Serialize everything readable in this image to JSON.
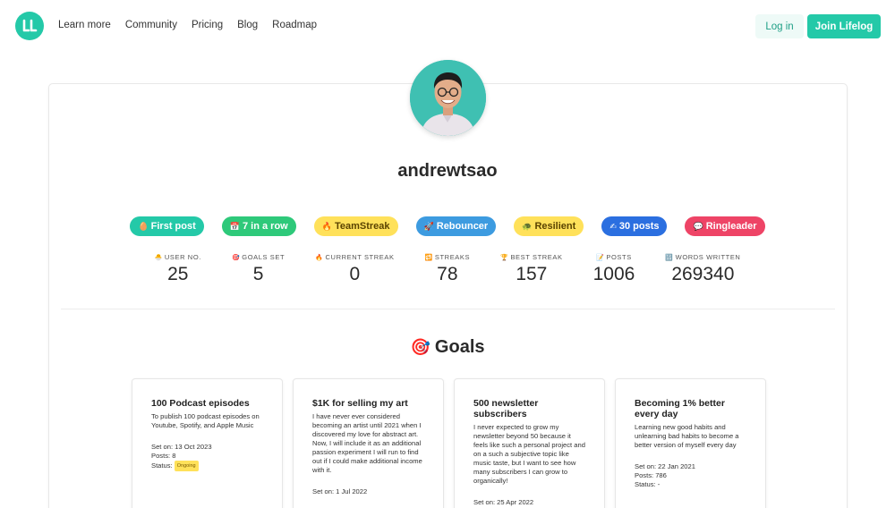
{
  "nav": {
    "links": [
      "Learn more",
      "Community",
      "Pricing",
      "Blog",
      "Roadmap"
    ],
    "login": "Log in",
    "join": "Join Lifelog"
  },
  "profile": {
    "username": "andrewtsao"
  },
  "badges": [
    {
      "label": "First post",
      "icon": "egg-icon",
      "bg": "#24c9a8",
      "fg": "#ffffff"
    },
    {
      "label": "7 in a row",
      "icon": "calendar-icon",
      "bg": "#2ec97a",
      "fg": "#ffffff"
    },
    {
      "label": "TeamStreak",
      "icon": "fire-icon",
      "bg": "#ffe15a",
      "fg": "#5a4300"
    },
    {
      "label": "Rebouncer",
      "icon": "rocket-icon",
      "bg": "#3d9be0",
      "fg": "#ffffff"
    },
    {
      "label": "Resilient",
      "icon": "turtle-icon",
      "bg": "#ffe15a",
      "fg": "#5a4300"
    },
    {
      "label": "30 posts",
      "icon": "writing-hand-icon",
      "bg": "#2b6fe0",
      "fg": "#ffffff"
    },
    {
      "label": "Ringleader",
      "icon": "speech-bubble-icon",
      "bg": "#ee4466",
      "fg": "#ffffff"
    }
  ],
  "stats": [
    {
      "label": "USER NO.",
      "value": "25",
      "icon": "hatching-chick-icon"
    },
    {
      "label": "GOALS SET",
      "value": "5",
      "icon": "target-icon"
    },
    {
      "label": "CURRENT STREAK",
      "value": "0",
      "icon": "fire-icon"
    },
    {
      "label": "STREAKS",
      "value": "78",
      "icon": "repeat-icon"
    },
    {
      "label": "BEST STREAK",
      "value": "157",
      "icon": "trophy-icon"
    },
    {
      "label": "POSTS",
      "value": "1006",
      "icon": "memo-icon"
    },
    {
      "label": "WORDS WRITTEN",
      "value": "269340",
      "icon": "numbers-icon"
    }
  ],
  "goals_section": {
    "title": "Goals"
  },
  "goals": [
    {
      "title": "100 Podcast episodes",
      "description": "To publish 100 podcast episodes on Youtube, Spotify, and Apple Music",
      "set_on": "Set on: 13 Oct 2023",
      "posts": "Posts: 8",
      "status": "Status:",
      "status_badge": "Ongoing"
    },
    {
      "title": "$1K for selling my art",
      "description": "I have never ever considered becoming an artist until 2021 when I discovered my love for abstract art. Now, I will include it as an additional passion experiment I will run to find out if I could make additional income with it.",
      "set_on": "Set on: 1 Jul 2022",
      "posts": "",
      "status": "",
      "status_badge": ""
    },
    {
      "title": "500 newsletter subscribers",
      "description": "I never expected to grow my newsletter beyond 50 because it feels like such a personal project and on a such a subjective topic like music taste, but I want to see how many subscribers I can grow to organically!",
      "set_on": "Set on: 25 Apr 2022",
      "posts": "",
      "status": "",
      "status_badge": ""
    },
    {
      "title": "Becoming 1% better every day",
      "description": "Learning new good habits and unlearning bad habits to become a better version of myself every day",
      "set_on": "Set on: 22 Jan 2021",
      "posts": "Posts: 786",
      "status": "Status: -",
      "status_badge": ""
    }
  ]
}
